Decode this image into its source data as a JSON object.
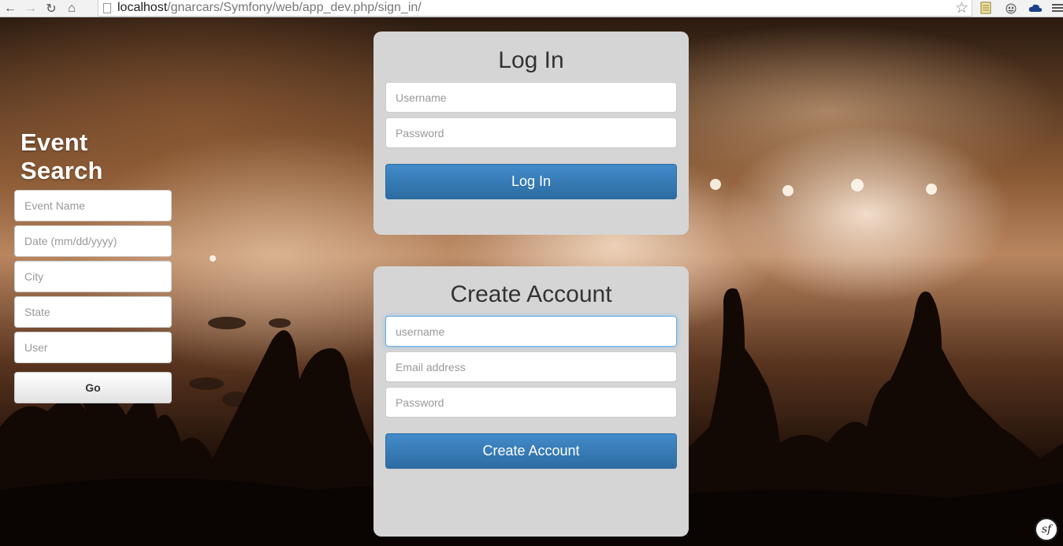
{
  "browser": {
    "url_host": "localhost",
    "url_path": "/gnarcars/Symfony/web/app_dev.php/sign_in/"
  },
  "event_search": {
    "title": "Event Search",
    "event_name_placeholder": "Event Name",
    "date_placeholder": "Date (mm/dd/yyyy)",
    "city_placeholder": "City",
    "state_placeholder": "State",
    "user_placeholder": "User",
    "go_label": "Go"
  },
  "login": {
    "title": "Log In",
    "username_placeholder": "Username",
    "password_placeholder": "Password",
    "submit_label": "Log In"
  },
  "create_account": {
    "title": "Create Account",
    "username_placeholder": "username",
    "email_placeholder": "Email address",
    "password_placeholder": "Password",
    "submit_label": "Create Account"
  },
  "symfony_badge": "sf",
  "colors": {
    "primary_button": "#428bca",
    "panel_bg": "#d5d5d5"
  }
}
